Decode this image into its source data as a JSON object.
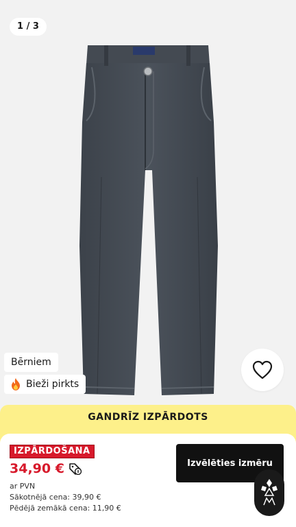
{
  "gallery": {
    "counter": "1 / 3",
    "product_image_icon": "jeans-image"
  },
  "badges": {
    "category": "Bērniem",
    "popular": "Bieži pirkts",
    "popular_icon": "fire-icon"
  },
  "favorite": {
    "icon": "heart-icon"
  },
  "banner": {
    "text": "GANDRĪZ IZPĀRDOTS"
  },
  "pricing": {
    "sale_label": "IZPĀRDOŠANA",
    "price": "34,90 €",
    "vat_note": "ar PVN",
    "original_price": "Sākotnējā cena: 39,90 €",
    "lowest_price": "Pēdējā zemākā cena: 11,90 €",
    "sale_color": "#d7192b"
  },
  "actions": {
    "choose_size": "Izvēlēties izmēru"
  },
  "assistant": {
    "icon": "assistant-logo-icon"
  }
}
